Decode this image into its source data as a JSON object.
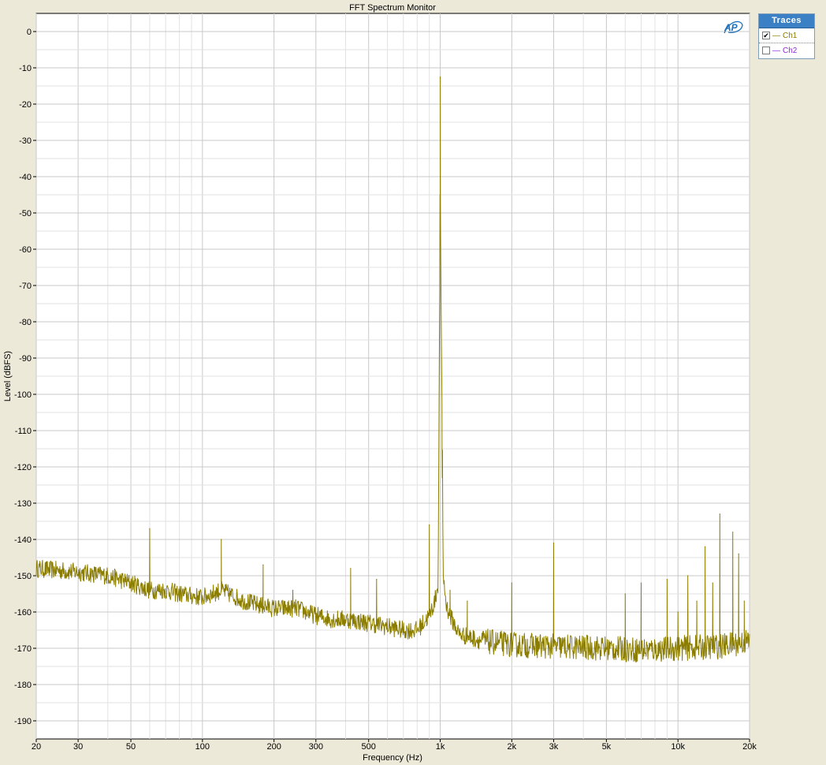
{
  "chart_data": {
    "type": "line",
    "title": "FFT Spectrum Monitor",
    "xlabel": "Frequency (Hz)",
    "ylabel": "Level (dBFS)",
    "x_scale": "log",
    "xlim": [
      20,
      20000
    ],
    "ylim": [
      -195,
      5
    ],
    "x_ticks": [
      20,
      30,
      50,
      100,
      200,
      300,
      500,
      1000,
      2000,
      3000,
      5000,
      10000,
      20000
    ],
    "x_tick_labels": [
      "20",
      "30",
      "50",
      "100",
      "200",
      "300",
      "500",
      "1k",
      "2k",
      "3k",
      "5k",
      "10k",
      "20k"
    ],
    "y_ticks": [
      0,
      -10,
      -20,
      -30,
      -40,
      -50,
      -60,
      -70,
      -80,
      -90,
      -100,
      -110,
      -120,
      -130,
      -140,
      -150,
      -160,
      -170,
      -180,
      -190
    ],
    "y_tick_labels": [
      "0",
      "-10",
      "-20",
      "-30",
      "-40",
      "-50",
      "-60",
      "-70",
      "-80",
      "-90",
      "-100",
      "-110",
      "-120",
      "-130",
      "-140",
      "-150",
      "-160",
      "-170",
      "-180",
      "-190"
    ],
    "grid": true,
    "legend_position": "top-right",
    "series": [
      {
        "name": "Ch1",
        "color": "#8b7d00",
        "visible": true,
        "floor": {
          "x": [
            20,
            30,
            40,
            50,
            60,
            70,
            80,
            100,
            120,
            150,
            170,
            200,
            250,
            300,
            350,
            400,
            500,
            600,
            700,
            800,
            900,
            950,
            980,
            1000,
            1030,
            1060,
            1100,
            1200,
            1500,
            2000,
            3000,
            5000,
            7000,
            10000,
            15000,
            20000
          ],
          "y": [
            -148,
            -149,
            -150,
            -152,
            -154,
            -154,
            -155,
            -156,
            -154,
            -157,
            -158,
            -159,
            -159,
            -161,
            -162,
            -162,
            -163,
            -164,
            -165,
            -165,
            -161,
            -157,
            -152,
            -45,
            -150,
            -158,
            -161,
            -166,
            -168,
            -169,
            -169.5,
            -170,
            -170.5,
            -170,
            -169.5,
            -168
          ]
        },
        "noise_amplitude": 2.5,
        "peaks": [
          {
            "x": 60,
            "y": -137
          },
          {
            "x": 120,
            "y": -140
          },
          {
            "x": 180,
            "y": -147
          },
          {
            "x": 240,
            "y": -154
          },
          {
            "x": 420,
            "y": -148
          },
          {
            "x": 540,
            "y": -151
          },
          {
            "x": 900,
            "y": -136
          },
          {
            "x": 1000,
            "y": -12.5
          },
          {
            "x": 1020,
            "y": -123
          },
          {
            "x": 1100,
            "y": -154
          },
          {
            "x": 1300,
            "y": -157
          },
          {
            "x": 2000,
            "y": -152
          },
          {
            "x": 3000,
            "y": -141
          },
          {
            "x": 6000,
            "y": -155
          },
          {
            "x": 7000,
            "y": -152
          },
          {
            "x": 9000,
            "y": -151
          },
          {
            "x": 10000,
            "y": -160
          },
          {
            "x": 11000,
            "y": -150
          },
          {
            "x": 12000,
            "y": -157
          },
          {
            "x": 13000,
            "y": -142
          },
          {
            "x": 14000,
            "y": -152
          },
          {
            "x": 15000,
            "y": -133
          },
          {
            "x": 17000,
            "y": -138
          },
          {
            "x": 18000,
            "y": -144
          },
          {
            "x": 19000,
            "y": -157
          }
        ]
      },
      {
        "name": "Ch2",
        "color": "#8a2bd9",
        "visible": false
      }
    ]
  },
  "legend": {
    "title": "Traces",
    "items": [
      {
        "label": "Ch1",
        "checked": "✔",
        "color": "#8b7d00"
      },
      {
        "label": "Ch2",
        "checked": "",
        "color": "#8a2bd9"
      }
    ]
  },
  "logo": {
    "text": "AP",
    "color": "#1e73be"
  },
  "colors": {
    "background": "#ece9d8",
    "plot_area": "#ffffff",
    "grid": "#c8c8c8",
    "axis": "#000000"
  }
}
